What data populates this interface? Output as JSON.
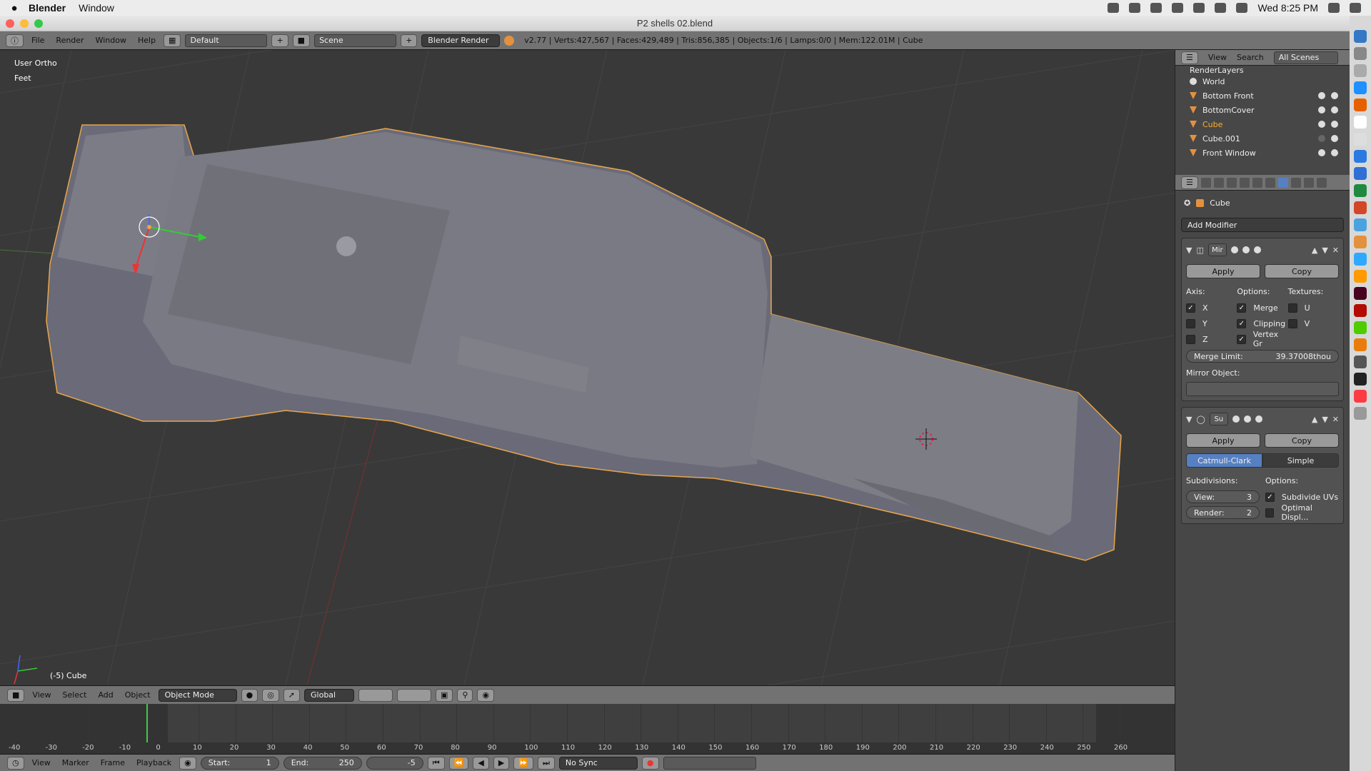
{
  "mac": {
    "apple": "",
    "app_name": "Blender",
    "menu": [
      "Window"
    ],
    "clock": "Wed 8:25 PM"
  },
  "window": {
    "title": "P2 shells 02.blend"
  },
  "info_header": {
    "menus": [
      "File",
      "Render",
      "Window",
      "Help"
    ],
    "layout": "Default",
    "scene": "Scene",
    "engine": "Blender Render",
    "stats": "v2.77 | Verts:427,567 | Faces:429,489 | Tris:856,385 | Objects:1/6 | Lamps:0/0 | Mem:122.01M | Cube"
  },
  "viewport": {
    "view_name": "User Ortho",
    "units": "Feet",
    "active_object": "(-5) Cube"
  },
  "viewport_header": {
    "menus": [
      "View",
      "Select",
      "Add",
      "Object"
    ],
    "mode": "Object Mode",
    "orientation": "Global"
  },
  "timeline": {
    "ticks": [
      "-40",
      "-30",
      "-20",
      "-10",
      "0",
      "10",
      "20",
      "30",
      "40",
      "50",
      "60",
      "70",
      "80",
      "90",
      "100",
      "110",
      "120",
      "130",
      "140",
      "150",
      "160",
      "170",
      "180",
      "190",
      "200",
      "210",
      "220",
      "230",
      "240",
      "250",
      "260"
    ],
    "menus": [
      "View",
      "Marker",
      "Frame",
      "Playback"
    ],
    "start_label": "Start:",
    "start": "1",
    "end_label": "End:",
    "end": "250",
    "current": "-5",
    "sync": "No Sync"
  },
  "outliner": {
    "menus": [
      "View",
      "Search"
    ],
    "scope": "All Scenes",
    "items": [
      {
        "name": "RenderLayers"
      },
      {
        "name": "World"
      },
      {
        "name": "Bottom Front"
      },
      {
        "name": "BottomCover"
      },
      {
        "name": "Cube"
      },
      {
        "name": "Cube.001"
      },
      {
        "name": "Front Window"
      }
    ]
  },
  "properties": {
    "context": "Cube",
    "add_modifier": "Add Modifier",
    "mirror": {
      "name": "Mir",
      "apply": "Apply",
      "copy": "Copy",
      "axis_label": "Axis:",
      "options_label": "Options:",
      "textures_label": "Textures:",
      "axes": [
        {
          "label": "X",
          "checked": true
        },
        {
          "label": "Y",
          "checked": false
        },
        {
          "label": "Z",
          "checked": false
        }
      ],
      "options": [
        {
          "label": "Merge",
          "checked": true
        },
        {
          "label": "Clipping",
          "checked": true
        },
        {
          "label": "Vertex Gr",
          "checked": true
        }
      ],
      "textures": [
        {
          "label": "U",
          "checked": false
        },
        {
          "label": "V",
          "checked": false
        }
      ],
      "merge_limit_label": "Merge Limit:",
      "merge_limit": "39.37008thou",
      "mirror_object_label": "Mirror Object:"
    },
    "subsurf": {
      "name": "Su",
      "apply": "Apply",
      "copy": "Copy",
      "type_on": "Catmull-Clark",
      "type_off": "Simple",
      "subdivisions_label": "Subdivisions:",
      "options_label": "Options:",
      "view_label": "View:",
      "view": "3",
      "render_label": "Render:",
      "render": "2",
      "opt1": "Subdivide UVs",
      "opt2": "Optimal Displ..."
    }
  },
  "colors": {
    "accent": "#5680c2",
    "selection_outline": "#e8a64a",
    "grid": "#444444"
  }
}
